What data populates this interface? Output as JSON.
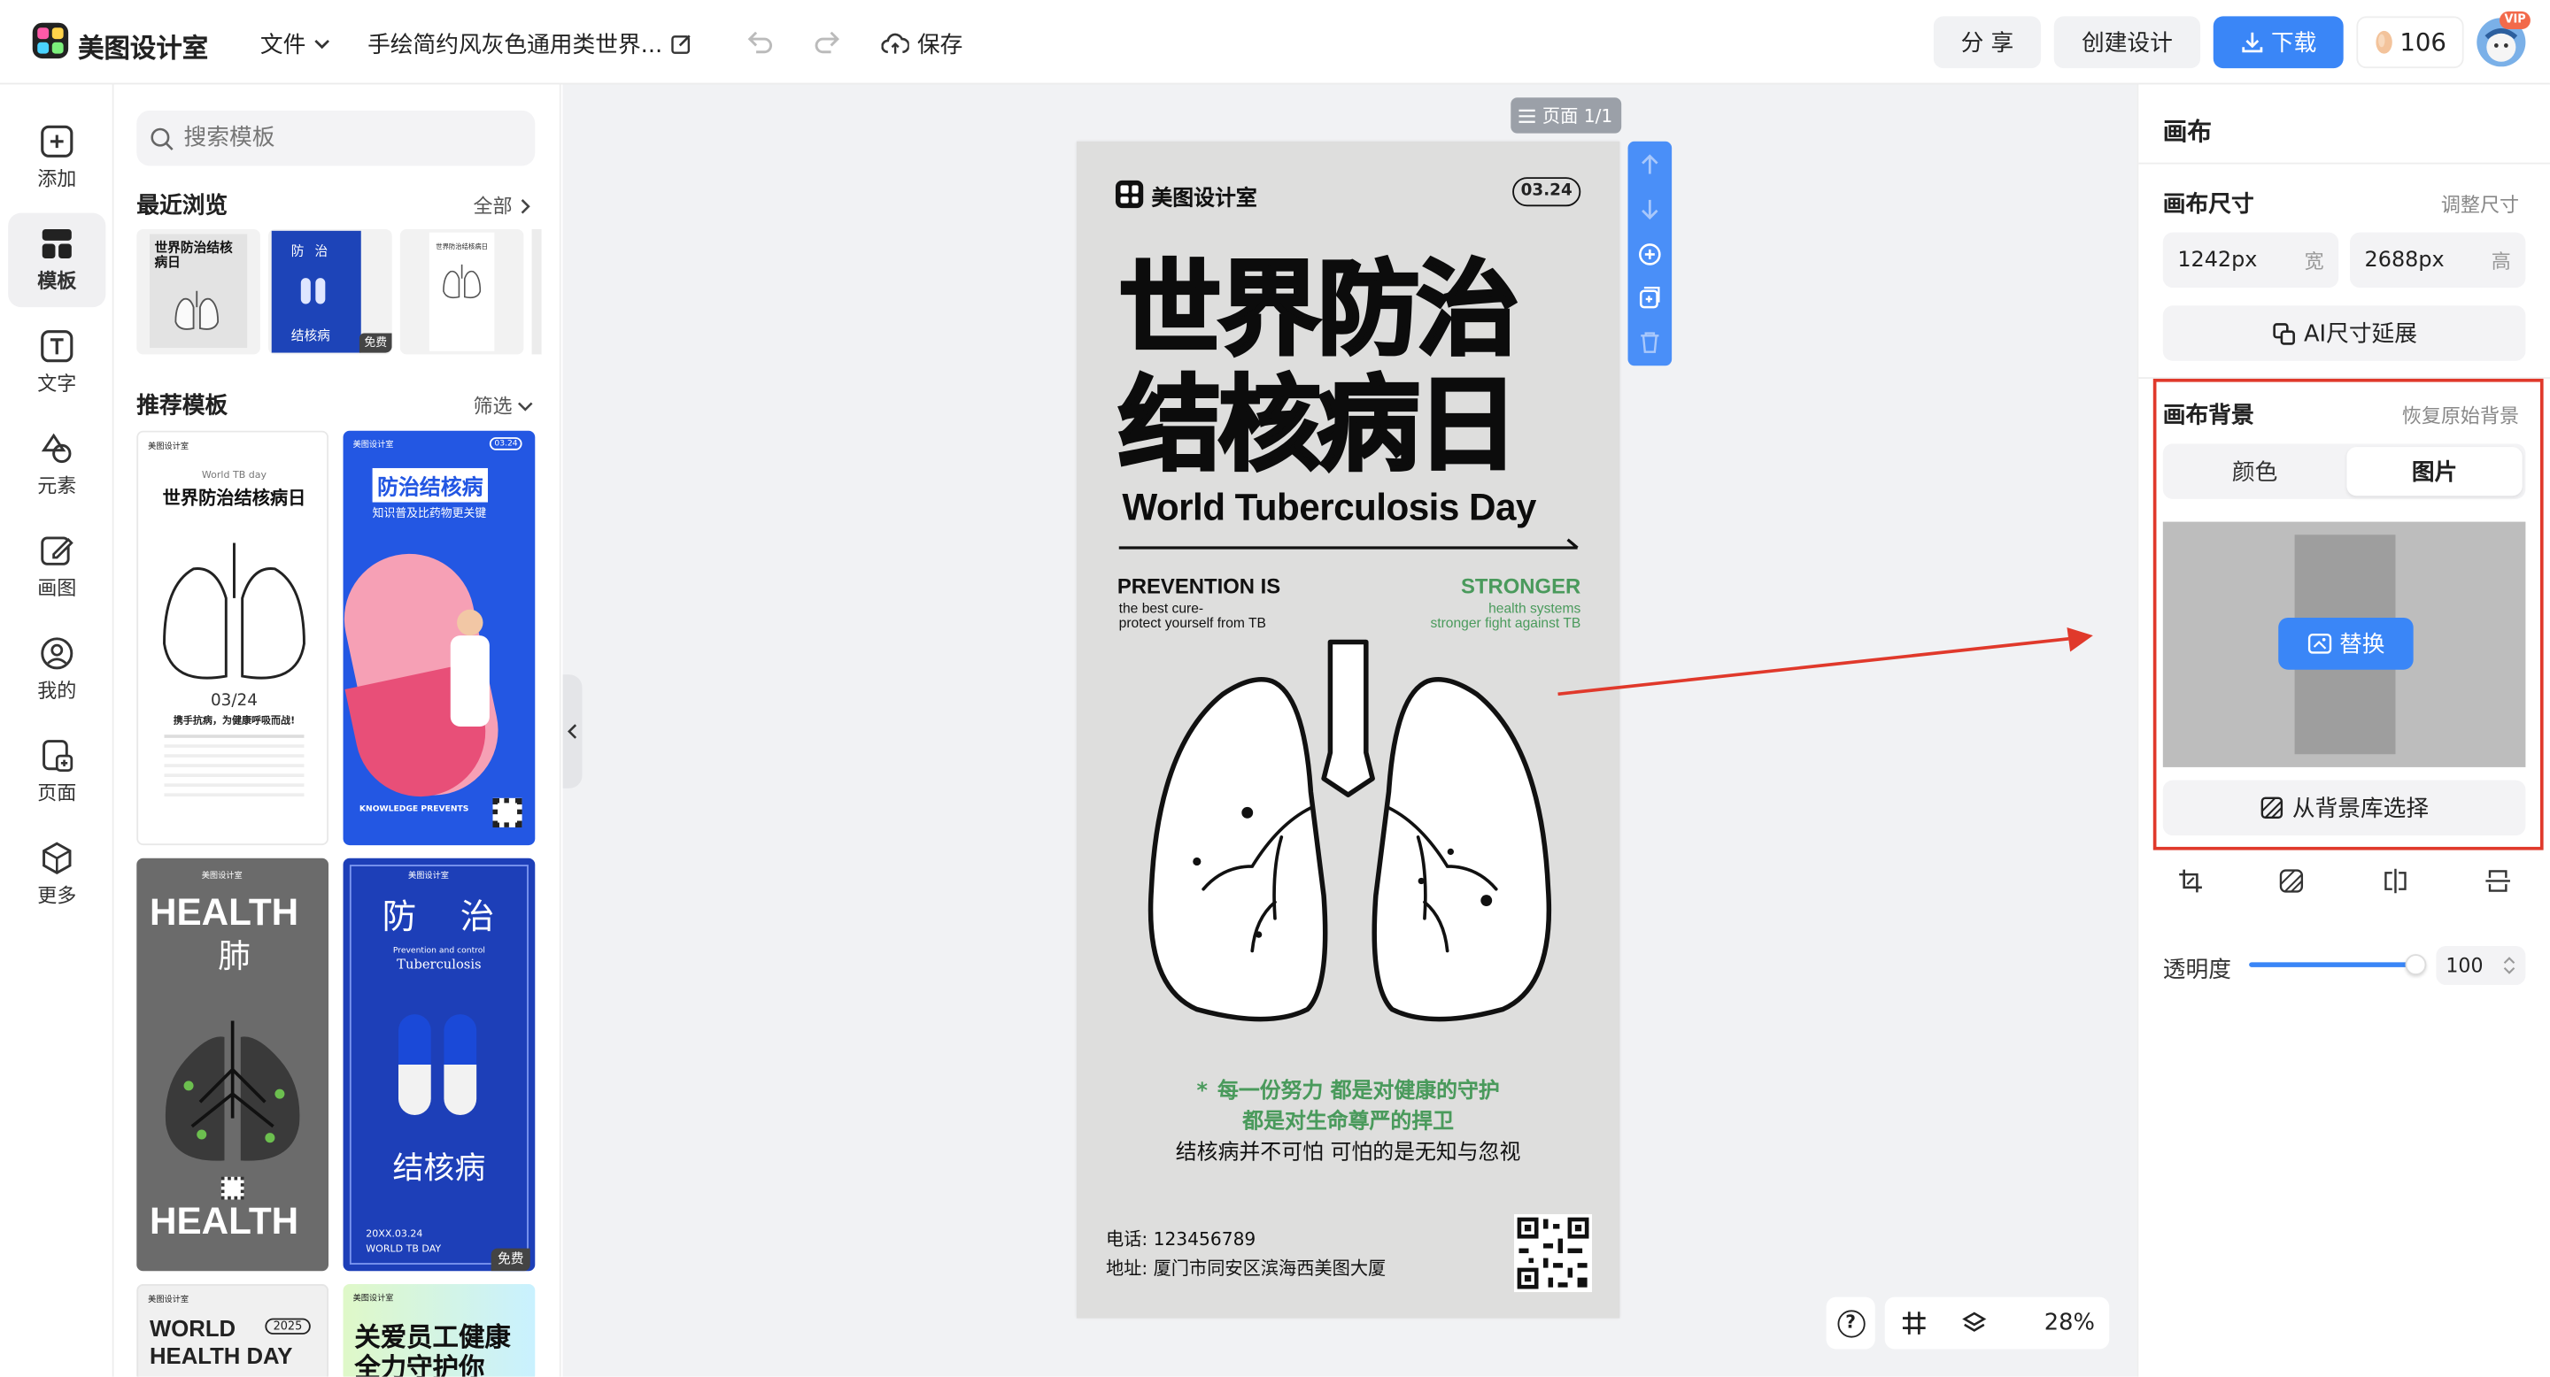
{
  "app": {
    "name": "美图设计室"
  },
  "topbar": {
    "file_menu": "文件",
    "doc_title": "手绘简约风灰色通用类世界...",
    "save_label": "保存",
    "share_label": "分 享",
    "create_label": "创建设计",
    "download_label": "下载",
    "credits": "106",
    "vip_badge": "VIP"
  },
  "rail": {
    "items": [
      {
        "label": "添加",
        "icon": "plus-square-icon"
      },
      {
        "label": "模板",
        "icon": "grid-template-icon",
        "active": true
      },
      {
        "label": "文字",
        "icon": "text-t-icon"
      },
      {
        "label": "元素",
        "icon": "shapes-icon"
      },
      {
        "label": "画图",
        "icon": "pencil-edit-icon"
      },
      {
        "label": "我的",
        "icon": "user-icon"
      },
      {
        "label": "页面",
        "icon": "page-add-icon"
      },
      {
        "label": "更多",
        "icon": "cube-icon"
      }
    ]
  },
  "panel": {
    "search_placeholder": "搜索模板",
    "recent_title": "最近浏览",
    "recent_all": "全部",
    "recommend_title": "推荐模板",
    "filter_label": "筛选",
    "free_badge": "免费",
    "recent_thumbs": [
      {
        "title": "世界防治结核病日"
      },
      {
        "title": "防 治",
        "sub": "结核病"
      },
      {
        "title": "世界防治结核病日"
      }
    ],
    "cards": [
      {
        "brand": "美图设计室",
        "small": "World TB day",
        "title": "世界防治结核病日",
        "date": "03/24",
        "slogan": "携手抗病，为健康呼吸而战!"
      },
      {
        "brand": "美图设计室",
        "date": "03.24",
        "title": "防治结核病",
        "sub": "知识普及比药物更关键",
        "tag": "KNOWLEDGE PREVENTS"
      },
      {
        "brand": "美图设计室",
        "title": "HEALTH",
        "mid": "肺",
        "bottom": "HEALTH"
      },
      {
        "brand": "美图设计室",
        "title1": "防",
        "title2": "治",
        "en1": "Prevention and control",
        "en2": "Tuberculosis",
        "cn": "结核病",
        "date": "20XX.03.24",
        "en3": "WORLD TB DAY"
      },
      {
        "brand": "美图设计室",
        "line1": "WORLD",
        "year": "2025",
        "line2": "HEALTH DAY"
      },
      {
        "brand": "美图设计室",
        "line1": "关爱员工健康",
        "line2": "全力守护你"
      }
    ]
  },
  "canvas": {
    "page_label": "页面 1/1",
    "zoom": "28%",
    "help": "?"
  },
  "poster": {
    "brand": "美图设计室",
    "date": "03.24",
    "title_line1": "世界防治",
    "title_line2": "结核病日",
    "title_en": "World Tuberculosis Day",
    "left_head": "PREVENTION IS",
    "left_sub1": "the best cure-",
    "left_sub2": "protect yourself from TB",
    "right_head": "STRONGER",
    "right_sub1": "health systems",
    "right_sub2": "stronger fight against TB",
    "slogan1": "每一份努力 都是对健康的守护",
    "slogan2": "都是对生命尊严的捍卫",
    "slogan3": "结核病并不可怕 可怕的是无知与忽视",
    "phone": "电话:  123456789",
    "address": "地址:  厦门市同安区滨海西美图大厦",
    "accent_color": "#4a9a5c"
  },
  "rpanel": {
    "title": "画布",
    "size_title": "画布尺寸",
    "adjust_size": "调整尺寸",
    "width_value": "1242px",
    "width_unit": "宽",
    "height_value": "2688px",
    "height_unit": "高",
    "ai_extend": "AI尺寸延展",
    "bg_title": "画布背景",
    "restore_bg": "恢复原始背景",
    "tab_color": "颜色",
    "tab_image": "图片",
    "replace_label": "替换",
    "from_library": "从背景库选择",
    "opacity_label": "透明度",
    "opacity_value": "100",
    "opacity_level": 1.0
  },
  "colors": {
    "primary": "#3a86f7",
    "annotation": "#e0392b"
  }
}
